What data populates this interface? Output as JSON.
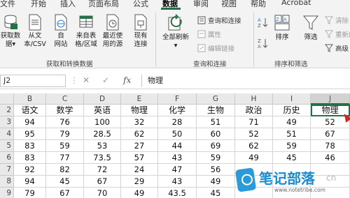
{
  "tabs": [
    "文件",
    "开始",
    "插入",
    "页面布局",
    "公式",
    "数据",
    "审阅",
    "视图",
    "帮助",
    "Acrobat"
  ],
  "active_tab": "数据",
  "ribbon": {
    "get_transform": {
      "get_data": "获取数\n据▾",
      "from_csv": "从文\n本/CSV",
      "from_web": "自\n网站",
      "from_table": "来自表\n格/区域",
      "recent_sources": "最近使\n用的源",
      "existing_conn": "现有\n连接",
      "label": "获取和转换数据"
    },
    "queries": {
      "refresh_all": "全部刷新\n▾",
      "queries_connections": "查询和连接",
      "properties": "属性",
      "edit_links": "编辑链接",
      "label": "查询和连接"
    },
    "sort_filter": {
      "sort": "排序",
      "filter": "筛选",
      "clear": "清除",
      "reapply": "重新应用",
      "advanced": "高级",
      "label": "排序和筛选"
    }
  },
  "formula_bar": {
    "name_box": "J2",
    "cancel": "✕",
    "enter": "✓",
    "fx": "fx",
    "content": "物理"
  },
  "columns": [
    "B",
    "C",
    "D",
    "E",
    "F",
    "G",
    "H",
    "I",
    "J"
  ],
  "selected_column": "J",
  "rows": [
    [
      "2",
      "语文",
      "数学",
      "英语",
      "物理",
      "化学",
      "生物",
      "政治",
      "历史",
      "物理"
    ],
    [
      "3",
      "94",
      "76",
      "100",
      "32",
      "28",
      "51",
      "71",
      "49",
      "52"
    ],
    [
      "4",
      "95",
      "79",
      "28.5",
      "62",
      "50",
      "60",
      "52",
      "51",
      "67"
    ],
    [
      "5",
      "83",
      "59",
      "53",
      "27",
      "44",
      "69",
      "62",
      "59",
      "78"
    ],
    [
      "6",
      "83",
      "77",
      "73.5",
      "57",
      "43",
      "59",
      "49",
      "45",
      "46"
    ],
    [
      "7",
      "92",
      "82",
      "72",
      "24",
      "47",
      "56",
      "",
      "",
      ""
    ],
    [
      "8",
      "94",
      "45",
      "67",
      "29",
      "43",
      "49",
      "",
      "",
      ""
    ],
    [
      "9",
      "79",
      "67",
      "70",
      "49",
      "43.5",
      "45",
      "",
      "",
      ""
    ]
  ],
  "watermark": {
    "text": "笔记部落",
    "url": "www.notetribe.com",
    "side": "cn"
  },
  "colors": {
    "accent": "#217346",
    "ribbon_bg": "#f3f3f3",
    "header_bg": "#e9e9e9",
    "cursor": "#d42424"
  }
}
